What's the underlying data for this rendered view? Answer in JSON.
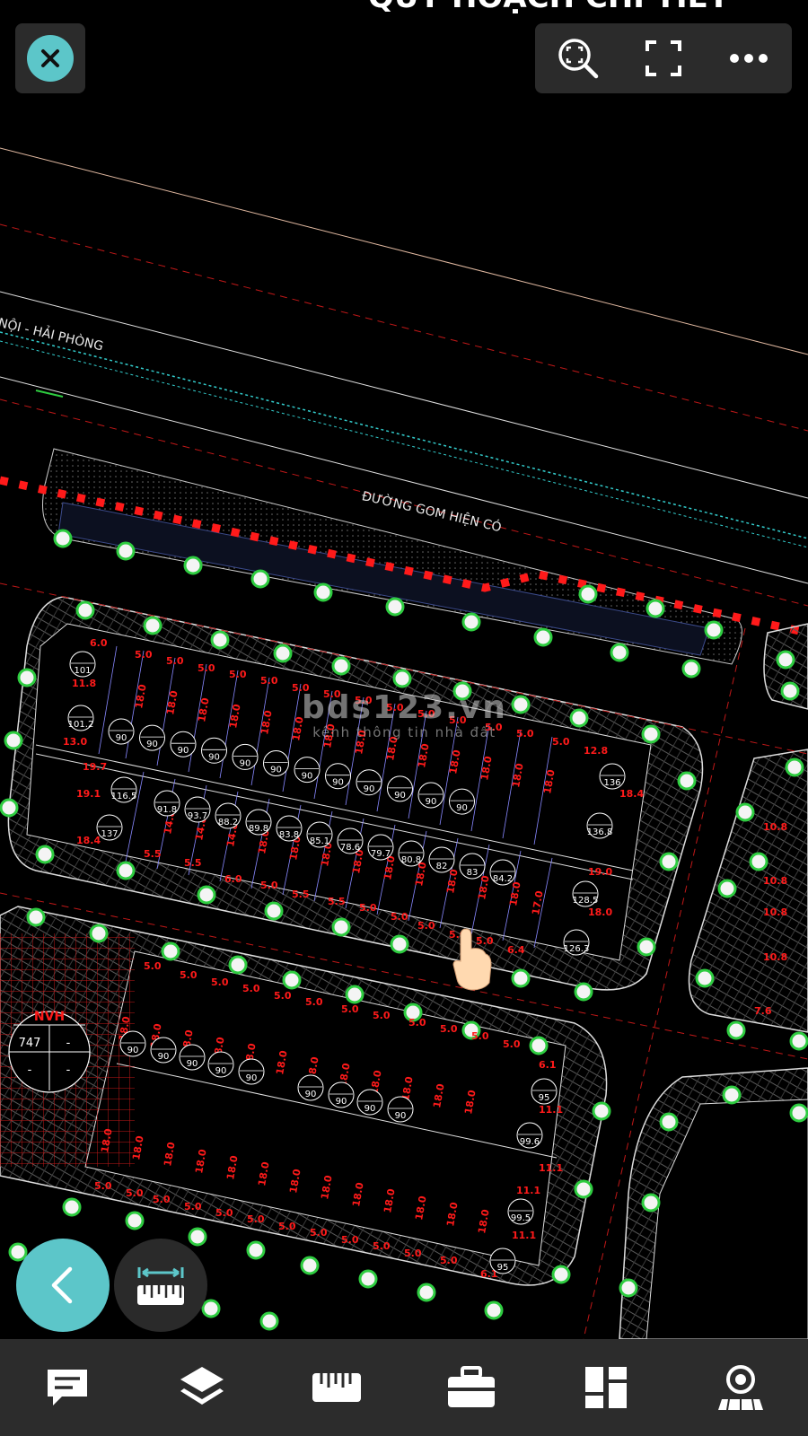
{
  "top_bar": {
    "close_icon": "close-icon",
    "icons": [
      "zoom-region-icon",
      "fullscreen-icon",
      "more-icon"
    ],
    "partial_title": "QUY HOẠCH CHI TIẾT"
  },
  "map": {
    "road_label_left": "NỘI - HẢI PHÒNG",
    "road_label_service": "ĐƯỜNG GOM HIỆN CÓ",
    "nvh_label": "NVH",
    "nvh_value": "747",
    "nvh_dash1": "-",
    "nvh_dash2": "-",
    "nvh_dash3": "-",
    "lot_areas_row1": [
      "101",
      "101.2",
      "90",
      "90",
      "90",
      "90",
      "90",
      "90",
      "90",
      "90",
      "90",
      "90",
      "90",
      "90",
      "136",
      "136.8"
    ],
    "lot_areas_row2": [
      "116.5",
      "137",
      "91.8",
      "93.7",
      "88.2",
      "89.8",
      "83.8",
      "85.1",
      "78.6",
      "79.7",
      "80.8",
      "82",
      "83",
      "84.2",
      "128.5",
      "126.3"
    ],
    "lot_areas_block2": [
      "90",
      "90",
      "90",
      "90",
      "90",
      "90",
      "90",
      "90",
      "90",
      "95",
      "99.6",
      "99.5",
      "95"
    ]
  },
  "watermark": {
    "title": "bds123.vn",
    "subtitle": "kênh thông tin nhà đất"
  },
  "fab": {
    "back_icon": "back-chevron-icon",
    "measure_icon": "ruler-measure-icon"
  },
  "bottom_bar": {
    "icons": [
      "comment-icon",
      "layers-icon",
      "ruler-icon",
      "toolbox-icon",
      "dashboard-icon",
      "location-view-icon"
    ]
  },
  "colors": {
    "accent": "#5cc6c9",
    "cad_red": "#ff1a1a",
    "background": "#000000",
    "bar_bg": "#2c2c2c"
  }
}
